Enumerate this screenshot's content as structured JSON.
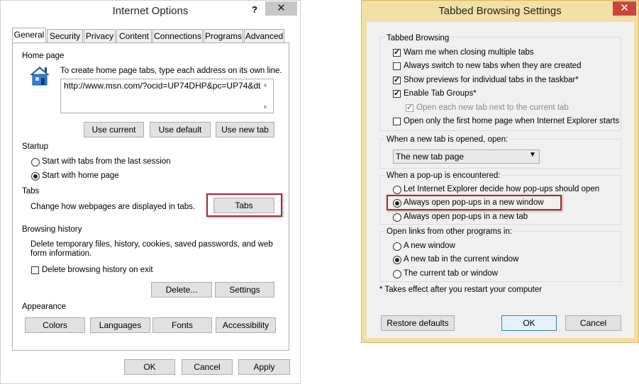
{
  "internet_options": {
    "title": "Internet Options",
    "help": "?",
    "close": "✕",
    "tabs": [
      "General",
      "Security",
      "Privacy",
      "Content",
      "Connections",
      "Programs",
      "Advanced"
    ],
    "active_tab": "General",
    "home_page": {
      "heading": "Home page",
      "instruction": "To create home page tabs, type each address on its own line.",
      "url": "http://www.msn.com/?ocid=UP74DHP&pc=UP74&dt",
      "buttons": [
        "Use current",
        "Use default",
        "Use new tab"
      ]
    },
    "startup": {
      "heading": "Startup",
      "options": [
        "Start with tabs from the last session",
        "Start with home page"
      ],
      "selected": "Start with home page"
    },
    "tabs_section": {
      "heading": "Tabs",
      "text": "Change how webpages are displayed in tabs.",
      "button": "Tabs"
    },
    "browsing_history": {
      "heading": "Browsing history",
      "text_line1": "Delete temporary files, history, cookies, saved passwords, and web",
      "text_line2": "form information.",
      "checkbox": "Delete browsing history on exit",
      "checkbox_checked": false,
      "buttons": [
        "Delete...",
        "Settings"
      ]
    },
    "appearance": {
      "heading": "Appearance",
      "buttons": [
        "Colors",
        "Languages",
        "Fonts",
        "Accessibility"
      ]
    },
    "footer": [
      "OK",
      "Cancel",
      "Apply"
    ]
  },
  "tabbed_browsing": {
    "title": "Tabbed Browsing Settings",
    "close": "✕",
    "section_tabbed": {
      "heading": "Tabbed Browsing",
      "options": [
        {
          "label": "Warn me when closing multiple tabs",
          "checked": true,
          "disabled": false
        },
        {
          "label": "Always switch to new tabs when they are created",
          "checked": false,
          "disabled": false
        },
        {
          "label": "Show previews for individual tabs in the taskbar*",
          "checked": true,
          "disabled": false
        },
        {
          "label": "Enable Tab Groups*",
          "checked": true,
          "disabled": false
        },
        {
          "label": "Open each new tab next to the current tab",
          "checked": true,
          "disabled": true
        },
        {
          "label": "Open only the first home page when Internet Explorer starts",
          "checked": false,
          "disabled": false
        }
      ]
    },
    "section_newtab": {
      "heading": "When a new tab is opened, open:",
      "selected": "The new tab page"
    },
    "section_popup": {
      "heading": "When a pop-up is encountered:",
      "options": [
        "Let Internet Explorer decide how pop-ups should open",
        "Always open pop-ups in a new window",
        "Always open pop-ups in a new tab"
      ],
      "selected_index": 1
    },
    "section_links": {
      "heading": "Open links from other programs in:",
      "options": [
        "A new window",
        "A new tab in the current window",
        "The current tab or window"
      ],
      "selected_index": 1
    },
    "footnote": "* Takes effect after you restart your computer",
    "buttons": [
      "Restore defaults",
      "OK",
      "Cancel"
    ]
  },
  "colors": {
    "highlight": "#b0262c",
    "tb_frame": "#f1dfa6",
    "close_red": "#c9463d"
  }
}
